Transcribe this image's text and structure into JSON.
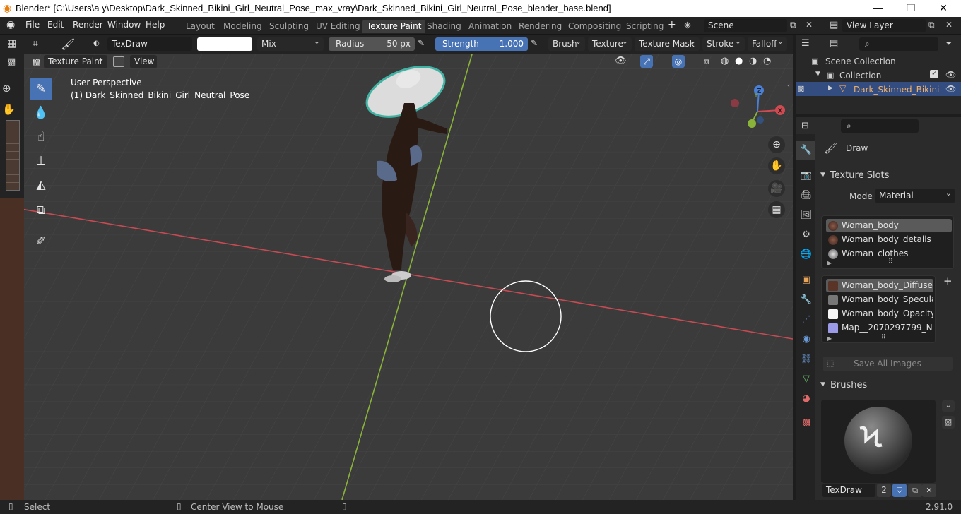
{
  "window": {
    "title": "Blender* [C:\\Users\\a y\\Desktop\\Dark_Skinned_Bikini_Girl_Neutral_Pose_max_vray\\Dark_Skinned_Bikini_Girl_Neutral_Pose_blender_base.blend]",
    "minimize": "—",
    "maximize": "❐",
    "close": "✕"
  },
  "menu": [
    "File",
    "Edit",
    "Render",
    "Window",
    "Help"
  ],
  "workspaces": [
    "Layout",
    "Modeling",
    "Sculpting",
    "UV Editing",
    "Texture Paint",
    "Shading",
    "Animation",
    "Rendering",
    "Compositing",
    "Scripting"
  ],
  "active_workspace": "Texture Paint",
  "scene": "Scene",
  "view_layer": "View Layer",
  "toolheader": {
    "brush_name": "TexDraw",
    "blend_mode": "Mix",
    "radius_label": "Radius",
    "radius_value": "50 px",
    "strength_label": "Strength",
    "strength_value": "1.000",
    "strength_fraction": 1.0,
    "menus": [
      "Brush",
      "Texture",
      "Texture Mask",
      "Stroke",
      "Falloff"
    ],
    "mode": "Texture Paint",
    "view": "View"
  },
  "viewport": {
    "perspective": "User Perspective",
    "object": "(1) Dark_Skinned_Bikini_Girl_Neutral_Pose",
    "gizmo": {
      "x": "X",
      "y": "Y",
      "z": "Z"
    }
  },
  "outliner": {
    "scene_collection": "Scene Collection",
    "collection": "Collection",
    "object": "Dark_Skinned_Bikini"
  },
  "properties": {
    "tool": "Draw",
    "texture_slots_title": "Texture Slots",
    "mode_label": "Mode",
    "mode_value": "Material",
    "materials": [
      "Woman_body",
      "Woman_body_details",
      "Woman_clothes"
    ],
    "images": [
      "Woman_body_Diffuse.p...",
      "Woman_body_Specular...",
      "Woman_body_Opacity....",
      "Map__2070297799_N..."
    ],
    "save_all": "Save All Images",
    "brushes_title": "Brushes",
    "brush_name": "TexDraw",
    "brush_users": "2"
  },
  "statusbar": {
    "select": "Select",
    "center": "Center View to Mouse",
    "version": "2.91.0"
  },
  "colors": {
    "accent": "#4772b3",
    "active_workspace_bg": "#3d3d3d",
    "viewport_bg": "#3b3b3b",
    "x_axis": "#d04a52",
    "y_axis": "#8ab33a"
  }
}
